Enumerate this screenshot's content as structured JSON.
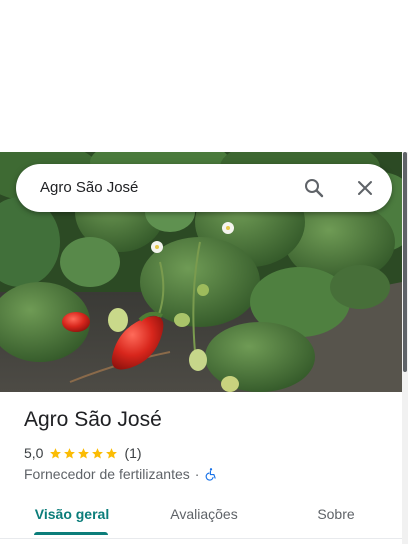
{
  "search": {
    "query": "Agro São José",
    "search_icon": "search-icon",
    "close_icon": "close-icon"
  },
  "hero": {
    "image": "strawberry-plant-photo"
  },
  "place": {
    "title": "Agro São José",
    "rating": "5,0",
    "stars": 5,
    "reviews": "(1)",
    "category": "Fornecedor de fertilizantes",
    "separator": "·",
    "accessibility_icon": "wheelchair-accessible-icon"
  },
  "tabs": [
    {
      "label": "Visão geral",
      "active": true
    },
    {
      "label": "Avaliações",
      "active": false
    },
    {
      "label": "Sobre",
      "active": false
    }
  ],
  "colors": {
    "accent": "#0b7d7a",
    "star": "#fbbc04",
    "accessibility": "#1a73e8"
  }
}
